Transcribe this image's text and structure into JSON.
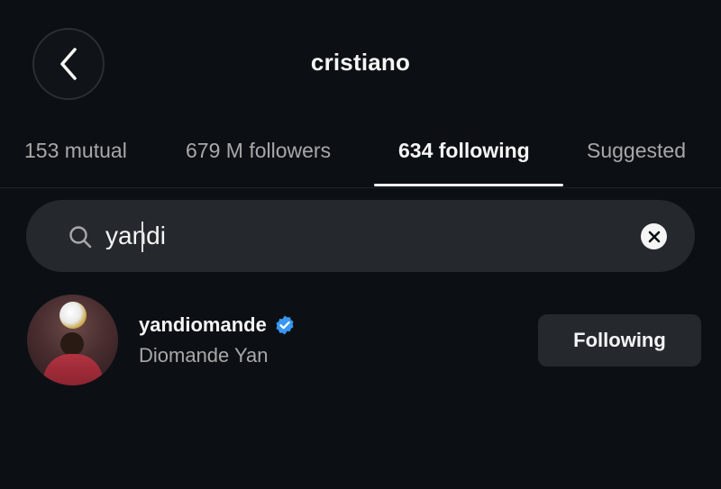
{
  "header": {
    "title": "cristiano"
  },
  "tabs": [
    {
      "label": "153 mutual",
      "active": false
    },
    {
      "label": "679 M followers",
      "active": false
    },
    {
      "label": "634 following",
      "active": true
    },
    {
      "label": "Suggested",
      "active": false
    }
  ],
  "search": {
    "value": "yandi"
  },
  "results": [
    {
      "username": "yandiomande",
      "full_name": "Diomande Yan",
      "verified": true,
      "button_label": "Following"
    }
  ],
  "colors": {
    "background": "#0c1014",
    "surface": "#25292e",
    "primary_text": "#f5f5f5",
    "secondary_text": "#a8a8a8",
    "verified_blue": "#3897f0"
  }
}
